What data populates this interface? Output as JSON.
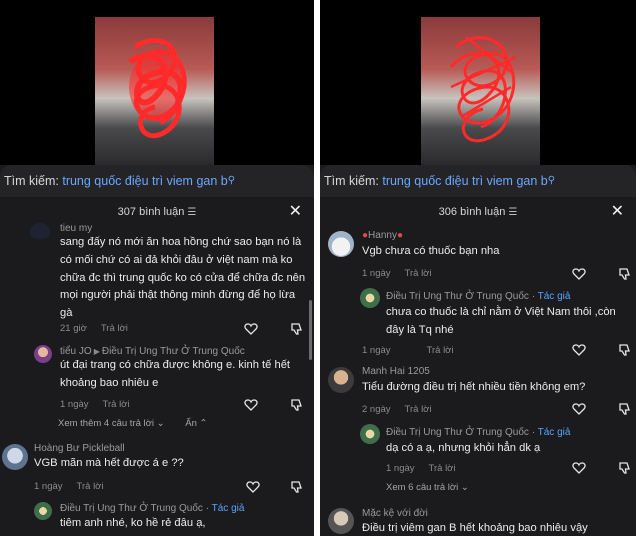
{
  "left": {
    "search": {
      "label": "Tìm kiếm:",
      "query": "trung quốc điệu trì viem gan b"
    },
    "comments_count": "307 bình luận",
    "comments": [
      {
        "name": "tieu my",
        "text": "sang đấy nó mới ăn hoa hồng chứ sao bạn nó là có mối chứ có ai đả khỏi đâu ở việt nam mà ko chữa đc thì trung quốc ko có cửa để chữa đc nên mọi người phải thật thông minh đừng để họ lừa gà",
        "time": "21 giờ",
        "reply": "Trả lời"
      },
      {
        "name": "tiểu JO",
        "reply_to": "Điều Trị Ung Thư Ở Trung Quốc",
        "text": "út đại trang có chữa được không e. kinh tế hết khoảng bao nhiêu e",
        "time": "1 ngày",
        "reply": "Trả lời"
      },
      {
        "view_more": "Xem thêm 4 câu trả lời",
        "hide": "Ẩn"
      },
      {
        "name": "Hoàng Bư Pickleball",
        "text": "VGB mãn mà hết được á e ??",
        "time": "1 ngày",
        "reply": "Trả lời"
      },
      {
        "name": "Điều Trị Ung Thư Ở Trung Quốc",
        "badge": "Tác giả",
        "text": "tiêm anh nhé, ko hề rẻ đâu ạ,"
      }
    ]
  },
  "right": {
    "search": {
      "label": "Tìm kiếm:",
      "query": "trung quốc điệu trì viem gan b"
    },
    "comments_count": "306 bình luận",
    "comments": [
      {
        "name": "Hanny",
        "text": "Vgb chưa có thuốc bạn nha",
        "time": "1 ngày",
        "reply": "Trả lời"
      },
      {
        "name": "Điều Trị Ung Thư Ở Trung Quốc",
        "badge": "Tác giả",
        "text": "chưa co thuốc là chỉ nằm ở Việt Nam thôi ,còn đây là Tq nhé",
        "time": "1 ngày",
        "reply": "Trả lời"
      },
      {
        "name": "Manh Hai 1205",
        "text": "Tiểu đường điều trị hết nhiều tiền không em?",
        "time": "2 ngày",
        "reply": "Trả lời"
      },
      {
        "name": "Điều Trị Ung Thư Ở Trung Quốc",
        "badge": "Tác giả",
        "text": "dạ có a ạ, nhưng khỏi hẳn dk ạ",
        "time": "1 ngày",
        "reply": "Trả lời"
      },
      {
        "view_more": "Xem 6 câu trả lời"
      },
      {
        "name": "Mặc kệ với đời",
        "text": "Điều trị viêm gan B hết khoảng bao nhiêu vậy"
      }
    ]
  },
  "icons": {
    "search": "search-icon",
    "filter": "filter-icon",
    "close": "close-icon",
    "like": "heart-outline-icon",
    "dislike": "thumbs-down-icon",
    "chevron": "chevron-down-icon",
    "chevron_up": "chevron-up-icon"
  },
  "colors": {
    "background": "#1b1b1d",
    "link": "#6aa7ff",
    "scribble": "#ff2a2a"
  }
}
